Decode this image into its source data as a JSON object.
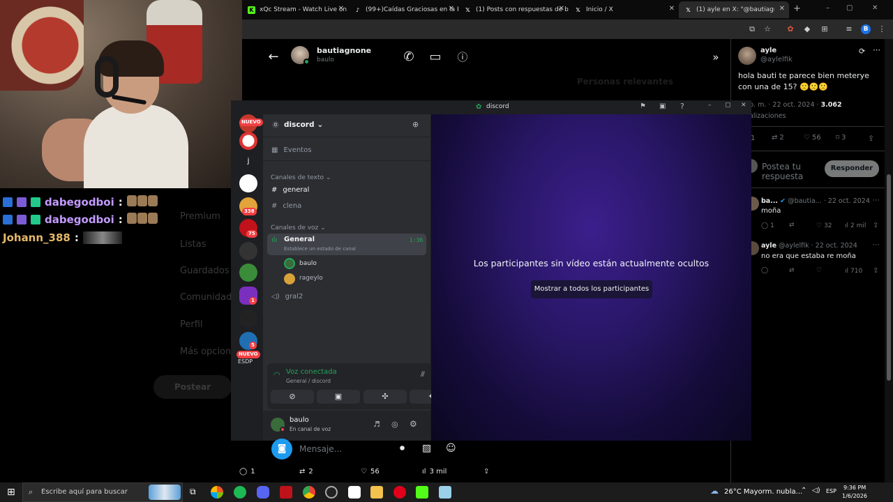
{
  "browser": {
    "tabs": [
      {
        "label": "xQc Stream - Watch Live on Kic",
        "icon": "kick-icon",
        "color": "#53fc18"
      },
      {
        "label": "(99+)Caídas Graciosas en la Esc",
        "icon": "tiktok-icon",
        "color": "#ffffff"
      },
      {
        "label": "(1) Posts con respuestas de bau",
        "icon": "x-icon",
        "color": "#ffffff"
      },
      {
        "label": "Inicio / X",
        "icon": "x-icon",
        "color": "#ffffff"
      },
      {
        "label": "(1) ayle en X: \"@bautiagnone ñ",
        "icon": "x-icon",
        "color": "#ffffff"
      }
    ],
    "new_tab": "+",
    "window_controls": [
      "–",
      "▢",
      "✕"
    ],
    "profile_initial": "B"
  },
  "chat": [
    {
      "user": "dabegodboi",
      "color": "#c39bff"
    },
    {
      "user": "dabegodboi",
      "color": "#c39bff"
    },
    {
      "user": "Johann_388",
      "color": "#e5b86a"
    }
  ],
  "x_sidebar": [
    "Premium",
    "Listas",
    "Guardados",
    "Comunidades",
    "Perfil",
    "Más opciones"
  ],
  "x_post_button": "Postear",
  "dm": {
    "name": "bautiagnone",
    "handle": "baulo",
    "bg_text": "Personas relevantes",
    "composer_placeholder": "Mensaje...",
    "stats": [
      {
        "icon": "reply-icon",
        "value": "1"
      },
      {
        "icon": "retweet-icon",
        "value": "2"
      },
      {
        "icon": "like-icon",
        "value": "56"
      },
      {
        "icon": "views-icon",
        "value": "3 mil"
      }
    ]
  },
  "tweet": {
    "author": "ayle",
    "handle": "@aylelfik",
    "text": "hola bauti te parece bien meterye con una de 15? 🙁🙁🙁",
    "meta_time": "p. m. · 22 oct. 2024 ·",
    "meta_views": "3.062",
    "meta_views_label": "alizaciones",
    "counts": {
      "reply": "1",
      "retweet": "2",
      "like": "56",
      "bookmark": "3"
    },
    "reply_placeholder": "Postea tu respuesta",
    "reply_button": "Responder"
  },
  "replies": [
    {
      "name": "ba...",
      "handle": "@bautia...",
      "date": "· 22 oct. 2024",
      "text": "moña",
      "counts": [
        "1",
        "",
        "32",
        "2 mil"
      ]
    },
    {
      "name": "ayle",
      "handle": "@aylelfik",
      "date": "· 22 oct. 2024",
      "text": "no era que estaba re moña",
      "counts": [
        "",
        "",
        "",
        "710"
      ]
    }
  ],
  "discord": {
    "window_title": "discord",
    "server_name": "discord",
    "server_count": "0",
    "events": "Eventos",
    "text_category": "Canales de texto",
    "text_channels": [
      "general",
      "clena"
    ],
    "voice_category": "Canales de voz",
    "voice_channel": "General",
    "voice_timer": "1:36",
    "voice_status": "Establece un estado de canal",
    "voice_members": [
      "baulo",
      "rageylo"
    ],
    "other_voice": "gral2",
    "connected_title": "Voz conectada",
    "connected_sub": "General / discord",
    "user_name": "baulo",
    "user_status": "En canal de voz",
    "hidden_msg": "Los participantes sin vídeo están actualmente ocultos",
    "show_all": "Mostrar a todos los participantes",
    "guild_badges": [
      "NUEVO",
      "338",
      "75",
      "1",
      "5",
      "NUEVO"
    ],
    "guild_letter": "j",
    "guild_esdp": "ESDP"
  },
  "taskbar": {
    "search": "Escribe aquí para buscar",
    "weather": "26°C  Mayorm. nubla...",
    "lang": "ESP",
    "time": "9:36 PM",
    "date": "1/6/2026"
  }
}
